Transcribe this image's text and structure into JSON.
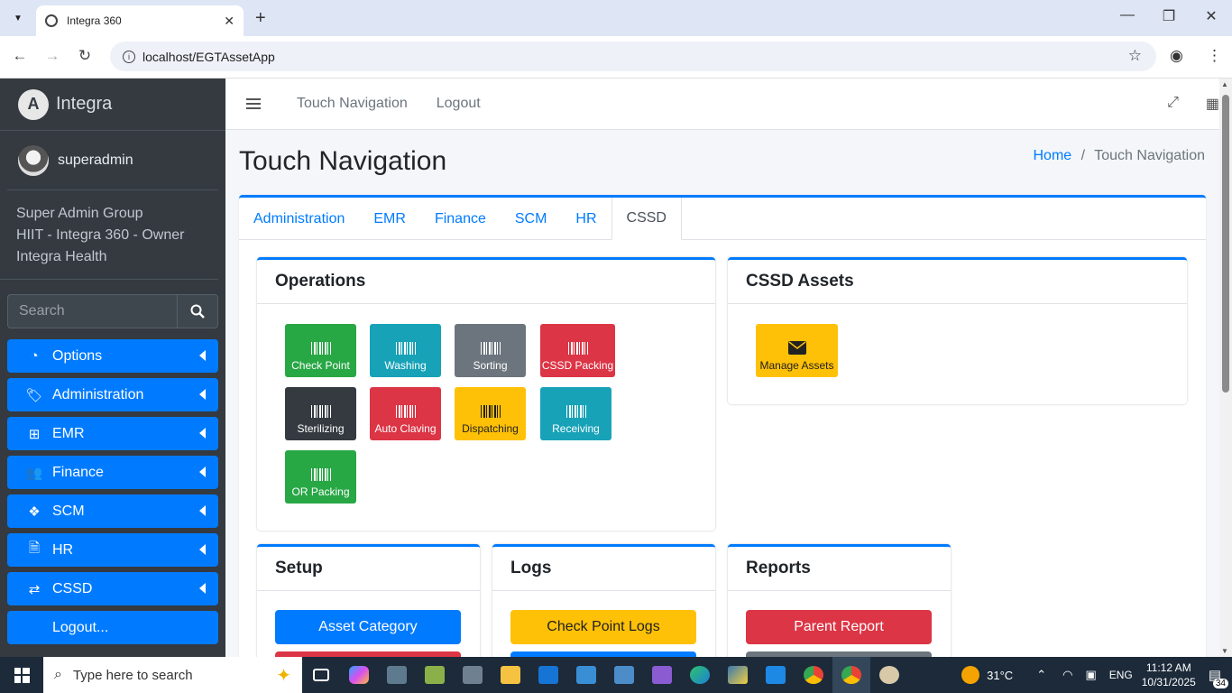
{
  "browser": {
    "tab_title": "Integra 360",
    "url": "localhost/EGTAssetApp"
  },
  "sidebar": {
    "brand": "Integra",
    "user": "superadmin",
    "groups": [
      "Super Admin Group",
      "HIIT - Integra 360 - Owner",
      "Integra Health"
    ],
    "search_placeholder": "Search",
    "items": [
      {
        "label": "Options",
        "icon": "gauge-icon"
      },
      {
        "label": "Administration",
        "icon": "tags-icon"
      },
      {
        "label": "EMR",
        "icon": "sitemap-icon"
      },
      {
        "label": "Finance",
        "icon": "users-icon"
      },
      {
        "label": "SCM",
        "icon": "cubes-icon"
      },
      {
        "label": "HR",
        "icon": "file-icon"
      },
      {
        "label": "CSSD",
        "icon": "exchange-icon"
      },
      {
        "label": "Logout..."
      }
    ]
  },
  "topbar": {
    "links": [
      "Touch Navigation",
      "Logout"
    ]
  },
  "page": {
    "title": "Touch Navigation",
    "breadcrumb_home": "Home",
    "breadcrumb_sep": "/",
    "breadcrumb_current": "Touch Navigation"
  },
  "tabs": [
    "Administration",
    "EMR",
    "Finance",
    "SCM",
    "HR",
    "CSSD"
  ],
  "active_tab": "CSSD",
  "operations": {
    "title": "Operations",
    "tiles": [
      {
        "label": "Check Point",
        "color": "#28a745"
      },
      {
        "label": "Washing",
        "color": "#17a2b8"
      },
      {
        "label": "Sorting",
        "color": "#6c757d"
      },
      {
        "label": "CSSD Packing",
        "color": "#dc3545"
      },
      {
        "label": "Sterilizing",
        "color": "#343a40"
      },
      {
        "label": "Auto Claving",
        "color": "#dc3545"
      },
      {
        "label": "Dispatching",
        "color": "#ffc107"
      },
      {
        "label": "Receiving",
        "color": "#17a2b8"
      },
      {
        "label": "OR Packing",
        "color": "#28a745"
      }
    ]
  },
  "cssd_assets": {
    "title": "CSSD Assets",
    "tile": {
      "label": "Manage Assets",
      "color": "#ffc107"
    }
  },
  "setup": {
    "title": "Setup",
    "button": "Asset Category"
  },
  "logs": {
    "title": "Logs",
    "button": "Check Point Logs"
  },
  "reports": {
    "title": "Reports",
    "button": "Parent Report"
  },
  "taskbar": {
    "search_placeholder": "Type here to search",
    "weather": "31°C",
    "lang": "ENG",
    "time": "11:12 AM",
    "date": "10/31/2025",
    "notifications": "34"
  }
}
